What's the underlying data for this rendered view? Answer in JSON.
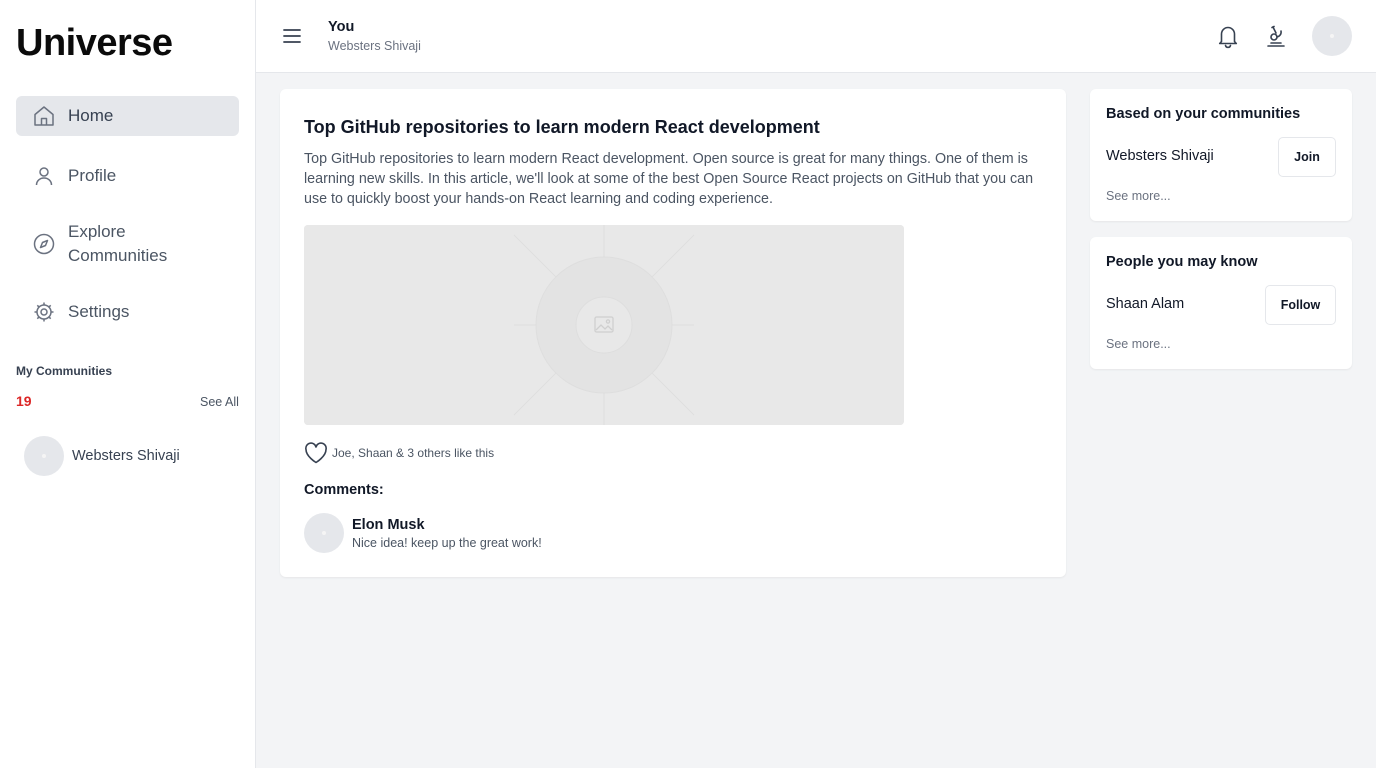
{
  "sidebar": {
    "brand": "Universe",
    "nav": [
      {
        "label": "Home",
        "icon": "home-icon",
        "active": true
      },
      {
        "label": "Profile",
        "icon": "user-icon"
      },
      {
        "label": "Explore",
        "label2": "Communities",
        "icon": "compass-icon"
      },
      {
        "label": "Settings",
        "icon": "gear-icon"
      }
    ],
    "my_communities": {
      "title": "My Communities",
      "count": "19",
      "see_all": "See All",
      "items": [
        {
          "name": "Websters Shivaji"
        }
      ]
    }
  },
  "header": {
    "title": "You",
    "subtitle": "Websters Shivaji",
    "icons": [
      "menu-icon",
      "bell-icon",
      "microscope-icon"
    ]
  },
  "post": {
    "title": "Top GitHub repositories to learn modern React development",
    "body": "Top GitHub repositories to learn modern React development. Open source is great for many things. One of them is learning new skills. In this article, we'll look at some of the best Open Source React projects on GitHub that you can use to quickly boost your hands-on React learning and coding experience.",
    "likes_text": "Joe, Shaan & 3 others like this",
    "comments_heading": "Comments:",
    "comments": [
      {
        "author": "Elon Musk",
        "text": "Nice idea! keep up the great work!"
      }
    ]
  },
  "right": {
    "communities": {
      "title": "Based on your communities",
      "name": "Websters Shivaji",
      "button": "Join",
      "see_more": "See more..."
    },
    "people": {
      "title": "People you may know",
      "name": "Shaan Alam",
      "button": "Follow",
      "see_more": "See more..."
    }
  },
  "colors": {
    "count_accent": "#dc2626",
    "active_nav_bg": "#e5e7eb",
    "page_bg": "#f3f4f6"
  }
}
